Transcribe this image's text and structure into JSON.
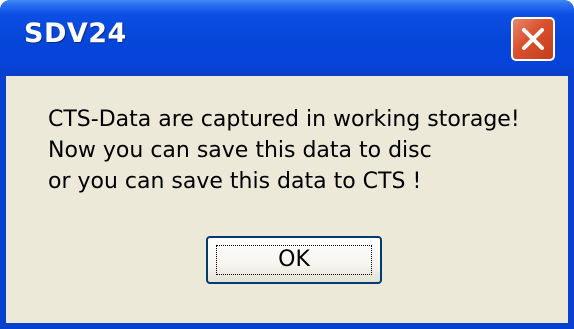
{
  "window": {
    "title": "SDV24",
    "close_icon": "close-x-icon"
  },
  "message": {
    "lines": [
      "CTS-Data are captured in working storage!",
      "Now you can save this data to disc",
      "or you can save this data to CTS !"
    ]
  },
  "buttons": {
    "ok_label": "OK"
  },
  "colors": {
    "titlebar": "#0645d8",
    "client_background": "#ece9d8",
    "close_button": "#d9502c"
  }
}
